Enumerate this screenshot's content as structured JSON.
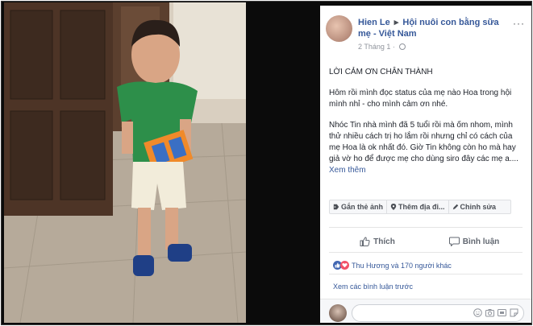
{
  "post": {
    "author": "Hien Le",
    "group": "Hội nuôi con bằng sữa mẹ - Việt Nam",
    "arrow": "▸",
    "more": "···",
    "date": "2 Tháng 1",
    "meta_dot": "·",
    "paragraph_1": "LỜI CẢM ƠN CHÂN THÀNH",
    "paragraph_2": "Hôm rồi mình đọc status của mẹ nào Hoa trong hội mình nhỉ - cho mình cảm ơn nhé.",
    "paragraph_3": "Nhóc Tin nhà mình đã 5 tuổi rồi mà ốm nhom, mình thử nhiều cách trị ho lắm rồi nhưng chỉ có cách của mẹ Hoa là ok nhất đó. Giờ Tin không còn ho mà hay giả vờ ho để được mẹ cho dùng siro đây các mẹ a....",
    "see_more": "Xem thêm"
  },
  "photo_actions": {
    "tag_photo": "Gắn thẻ ảnh",
    "add_location": "Thêm địa đi...",
    "edit": "Chỉnh sửa"
  },
  "actions": {
    "like": "Thích",
    "comment": "Bình luận"
  },
  "reactions": {
    "summary": "Thu Hương và 170 người khác"
  },
  "comments": {
    "view_previous": "Xem các bình luận trước"
  },
  "colors": {
    "link_blue": "#365899",
    "like_blue": "#4267b2",
    "love_red": "#f25268"
  }
}
